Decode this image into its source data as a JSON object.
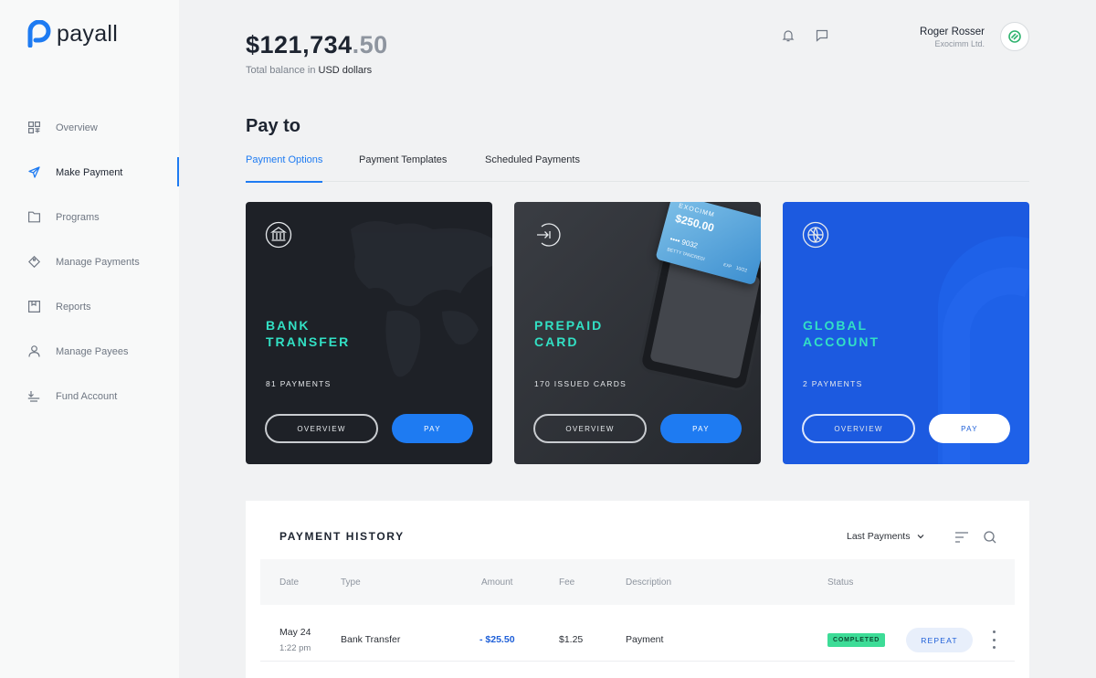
{
  "brand": {
    "name": "payall",
    "accent": "#1e7bf2"
  },
  "sidebar": {
    "items": [
      {
        "label": "Overview",
        "icon": "grid-icon"
      },
      {
        "label": "Make Payment",
        "icon": "send-icon",
        "active": true
      },
      {
        "label": "Programs",
        "icon": "folder-icon"
      },
      {
        "label": "Manage Payments",
        "icon": "tag-icon"
      },
      {
        "label": "Reports",
        "icon": "report-icon"
      },
      {
        "label": "Manage Payees",
        "icon": "user-icon"
      },
      {
        "label": "Fund Account",
        "icon": "fund-icon"
      }
    ]
  },
  "header": {
    "balance_main": "$121,734",
    "balance_cents": ".50",
    "balance_caption_prefix": "Total balance in ",
    "balance_caption_currency": "USD dollars",
    "user_name": "Roger Rosser",
    "user_company": "Exocimm Ltd."
  },
  "pay": {
    "title": "Pay to",
    "tabs": [
      "Payment Options",
      "Payment Templates",
      "Scheduled Payments"
    ],
    "cards": [
      {
        "title_line1": "BANK",
        "title_line2": "TRANSFER",
        "subtitle": "81 PAYMENTS",
        "overview_label": "OVERVIEW",
        "pay_label": "PAY",
        "icon": "bank-icon"
      },
      {
        "title_line1": "PREPAID",
        "title_line2": "CARD",
        "subtitle": "170 ISSUED CARDS",
        "overview_label": "OVERVIEW",
        "pay_label": "PAY",
        "icon": "card-exit-icon",
        "card_art": {
          "brand": "EXOCIMM",
          "amount": "$250.00",
          "number": "•••• 9032",
          "holder": "BETTY TANCREDI",
          "exp_label": "EXP",
          "exp": "10/22"
        }
      },
      {
        "title_line1": "GLOBAL",
        "title_line2": "ACCOUNT",
        "subtitle": "2 PAYMENTS",
        "overview_label": "OVERVIEW",
        "pay_label": "PAY",
        "icon": "globe-icon"
      }
    ]
  },
  "history": {
    "title": "PAYMENT HISTORY",
    "filter": "Last Payments",
    "columns": [
      "Date",
      "Type",
      "Amount",
      "Fee",
      "Description",
      "Status"
    ],
    "rows": [
      {
        "date": "May 24",
        "time": "1:22 pm",
        "type": "Bank Transfer",
        "amount": "- $25.50",
        "fee": "$1.25",
        "description": "Payment",
        "status": "COMPLETED",
        "action": "REPEAT"
      }
    ]
  }
}
